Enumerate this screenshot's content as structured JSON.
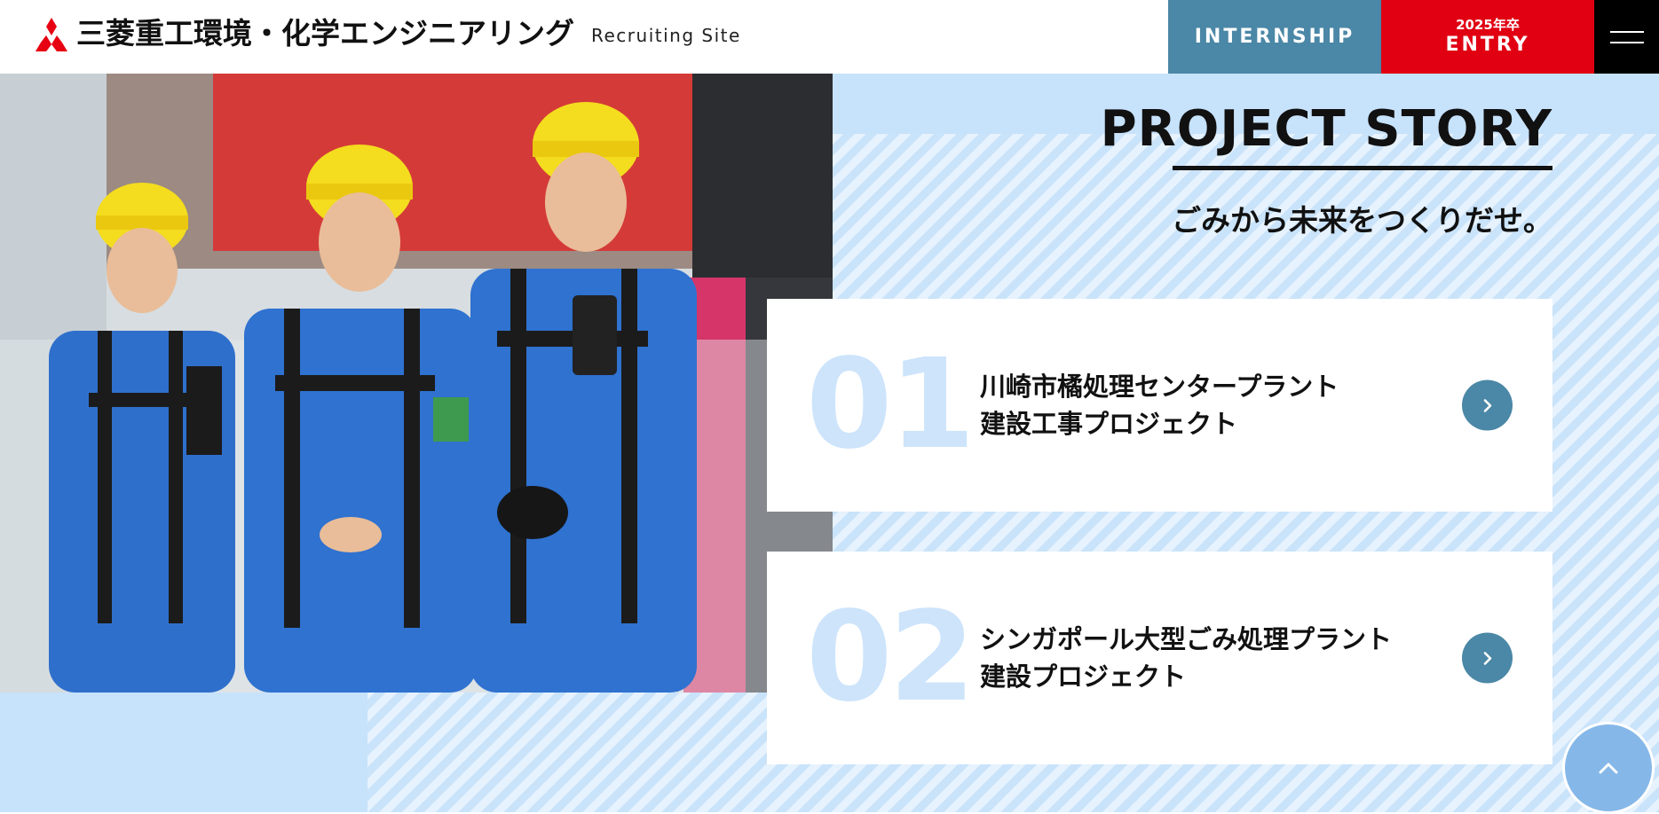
{
  "header": {
    "company_name": "三菱重工環境・化学エンジニアリング",
    "site_label": "Recruiting Site",
    "internship_label": "INTERNSHIP",
    "entry_year_label": "2025年卒",
    "entry_label": "ENTRY",
    "logo_icon": "three-diamonds-icon",
    "menu_icon": "hamburger-icon"
  },
  "main": {
    "photo_alt": "Three workers in blue uniforms and yellow helmets at a construction site",
    "title": "PROJECT STORY",
    "subtitle": "ごみから未来をつくりだせ。",
    "projects": [
      {
        "number": "01",
        "title_line1": "川崎市橘処理センタープラント",
        "title_line2": "建設工事プロジェクト"
      },
      {
        "number": "02",
        "title_line1": "シンガポール大型ごみ処理プラント",
        "title_line2": "建設プロジェクト"
      }
    ],
    "arrow_icon": "chevron-right-icon"
  },
  "pagetop": {
    "icon": "chevron-up-icon"
  },
  "colors": {
    "internship_bg": "#4b87a6",
    "entry_bg": "#e00012",
    "menu_bg": "#000000",
    "light_blue": "#c7e2fb",
    "number_color": "#cde4fb",
    "pagetop_bg": "#85b8e8"
  }
}
